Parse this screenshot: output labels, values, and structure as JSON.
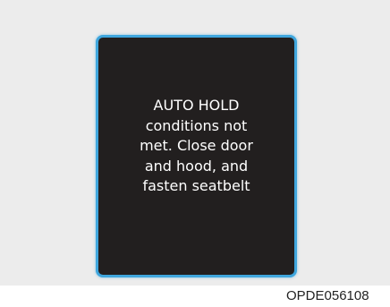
{
  "display": {
    "message_lines": [
      "AUTO HOLD",
      "conditions not",
      "met. Close door",
      "and hood, and",
      "fasten seatbelt"
    ]
  },
  "figure": {
    "code": "OPDE056108"
  },
  "colors": {
    "panel_background": "#ececec",
    "screen_background": "#221f1f",
    "screen_border": "#3fa6dd",
    "text": "#ffffff"
  }
}
